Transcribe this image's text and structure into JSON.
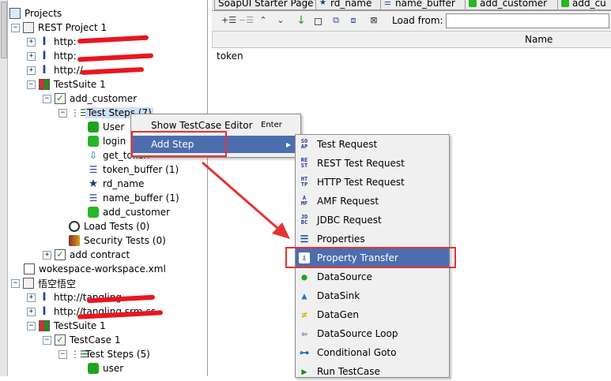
{
  "tabs": [
    {
      "label": "SoapUI Starter Page"
    },
    {
      "label": "rd_name"
    },
    {
      "label": "name_buffer"
    },
    {
      "label": "add_customer"
    },
    {
      "label": "add_cu"
    }
  ],
  "toolbar": {
    "load_from_label": "Load from:",
    "load_from_value": ""
  },
  "grid": {
    "column_header": "Name",
    "rows": [
      "token"
    ]
  },
  "tree": {
    "root": "Projects",
    "project1": "REST Project 1",
    "http1": "http:",
    "http2": "http:",
    "http3": "http://",
    "suite1": "TestSuite 1",
    "case_add_customer": "add_customer",
    "test_steps": "Test Steps (7)",
    "step_user": "User",
    "step_login": "login",
    "step_get_token": "get_token",
    "step_token_buffer": "token_buffer (1)",
    "step_rd_name": "rd_name",
    "step_name_buffer": "name_buffer (1)",
    "step_add_customer": "add_customer",
    "load_tests": "Load Tests (0)",
    "security_tests": "Security Tests (0)",
    "case_add_contract": "add contract",
    "workspace": "wokespace-workspace.xml",
    "project2": "悟空悟空",
    "p2_http1": "http://tangling",
    "p2_http2": "http://tangling.srm.cs",
    "p2_suite": "TestSuite 1",
    "p2_case": "TestCase 1",
    "p2_steps": "Test Steps (5)",
    "p2_user": "user"
  },
  "context_menu": {
    "show_editor": "Show TestCase Editor",
    "show_editor_shortcut": "Enter",
    "add_step": "Add Step"
  },
  "add_step_menu": [
    {
      "label": "Test Request",
      "icon": "soap-icon",
      "glyph": "SO AP"
    },
    {
      "label": "REST Test Request",
      "icon": "rest-icon",
      "glyph": "RE ST"
    },
    {
      "label": "HTTP Test Request",
      "icon": "http-icon",
      "glyph": "HT TP"
    },
    {
      "label": "AMF Request",
      "icon": "amf-icon",
      "glyph": "A MF"
    },
    {
      "label": "JDBC Request",
      "icon": "jdbc-icon",
      "glyph": "JD BC"
    },
    {
      "label": "Properties",
      "icon": "list-icon",
      "glyph": "☰"
    },
    {
      "label": "Property Transfer",
      "icon": "transfer-icon",
      "glyph": "⇩"
    },
    {
      "label": "DataSource",
      "icon": "datasource-icon",
      "glyph": "●"
    },
    {
      "label": "DataSink",
      "icon": "datasink-icon",
      "glyph": "▲"
    },
    {
      "label": "DataGen",
      "icon": "datagen-icon",
      "glyph": "≠"
    },
    {
      "label": "DataSource Loop",
      "icon": "loop-icon",
      "glyph": "⇦"
    },
    {
      "label": "Conditional Goto",
      "icon": "goto-icon",
      "glyph": "⊶"
    },
    {
      "label": "Run TestCase",
      "icon": "run-icon",
      "glyph": "▶"
    }
  ],
  "colors": {
    "menu_highlight": "#4c6eae",
    "annotation_red": "#e53333",
    "tree_selection": "#cfe0f7"
  }
}
